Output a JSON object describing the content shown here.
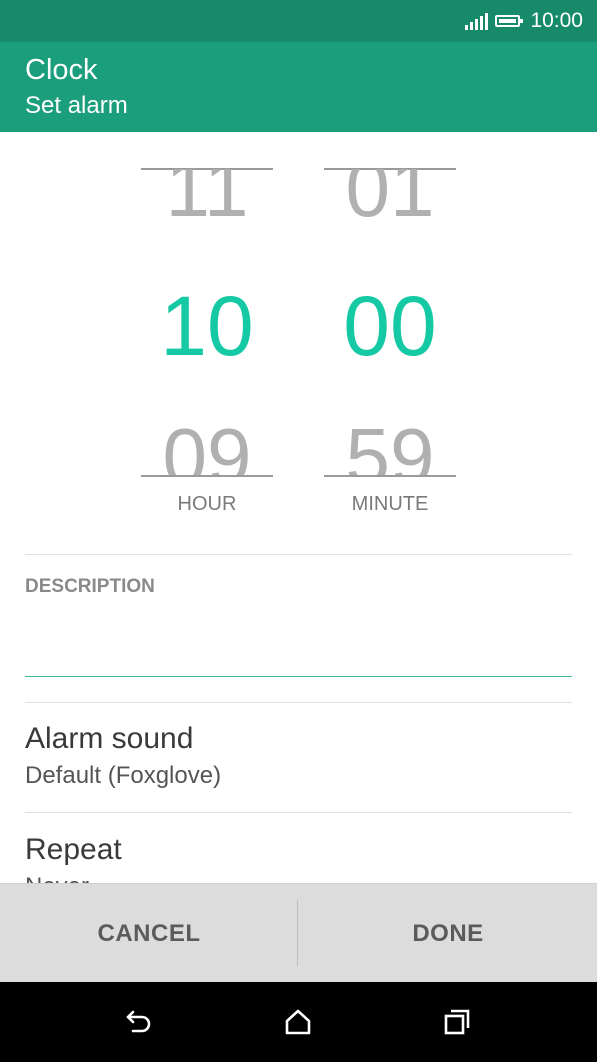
{
  "status_bar": {
    "time": "10:00"
  },
  "app_bar": {
    "title": "Clock",
    "subtitle": "Set alarm"
  },
  "picker": {
    "hour": {
      "prev": "11",
      "current": "10",
      "next": "09",
      "label": "HOUR"
    },
    "minute": {
      "prev": "01",
      "current": "00",
      "next": "59",
      "label": "MINUTE"
    }
  },
  "description": {
    "label": "DESCRIPTION",
    "value": ""
  },
  "alarm_sound": {
    "title": "Alarm sound",
    "value": "Default (Foxglove)"
  },
  "repeat": {
    "title": "Repeat",
    "value": "Never"
  },
  "buttons": {
    "cancel": "CANCEL",
    "done": "DONE"
  },
  "colors": {
    "status_bar": "#178a6a",
    "app_bar": "#1a9e7b",
    "accent": "#14c9a4",
    "inactive_number": "#b0b0b0",
    "button_bar": "#dcdcdc"
  },
  "icons": {
    "signal": "signal-icon",
    "battery": "battery-icon",
    "back": "back-icon",
    "home": "home-icon",
    "recent": "recent-apps-icon"
  }
}
